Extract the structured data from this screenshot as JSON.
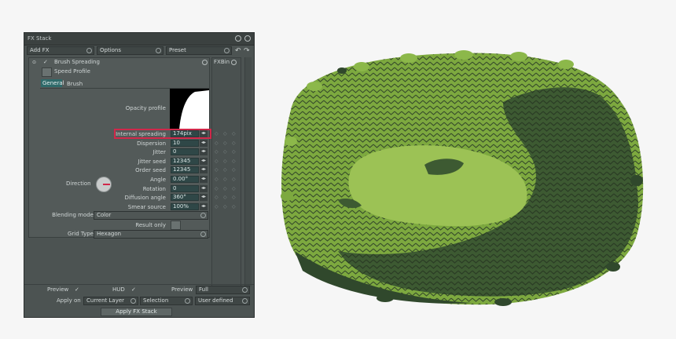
{
  "window": {
    "title": "FX Stack"
  },
  "top_controls": {
    "add_fx": "Add FX",
    "options": "Options",
    "preset": "Preset"
  },
  "layer": {
    "name": "Brush Spreading",
    "speed_profile": "Speed Profile",
    "fxbin": "FXBin"
  },
  "tabs": [
    {
      "label": "General"
    },
    {
      "label": "Brush"
    }
  ],
  "params": {
    "opacity_profile": "Opacity profile",
    "direction": "Direction",
    "rows": [
      {
        "label": "Internal spreading",
        "value": "174pix"
      },
      {
        "label": "Dispersion",
        "value": "10"
      },
      {
        "label": "Jitter",
        "value": "0"
      },
      {
        "label": "Jitter seed",
        "value": "12345"
      },
      {
        "label": "Order seed",
        "value": "12345"
      },
      {
        "label": "Angle",
        "value": "0.00°"
      },
      {
        "label": "Rotation",
        "value": "0"
      },
      {
        "label": "Diffusion angle",
        "value": "360°"
      },
      {
        "label": "Smear source",
        "value": "100%"
      }
    ],
    "blending_mode_label": "Blending mode",
    "blending_mode_value": "Color",
    "result_only": "Result only",
    "grid_type_label": "Grid Type",
    "grid_type_value": "Hexagon"
  },
  "footer": {
    "preview": "Preview",
    "hud": "HUD",
    "preview2": "Preview",
    "preview2_value": "Full",
    "apply_on": "Apply on",
    "current_layer": "Current Layer",
    "selection": "Selection",
    "user_defined": "User defined",
    "apply_button": "Apply FX Stack"
  },
  "colors": {
    "highlight": "#d0284a",
    "dark_green": "#30482c",
    "mid_green": "#5f8a34",
    "light_green": "#8cb84a"
  }
}
